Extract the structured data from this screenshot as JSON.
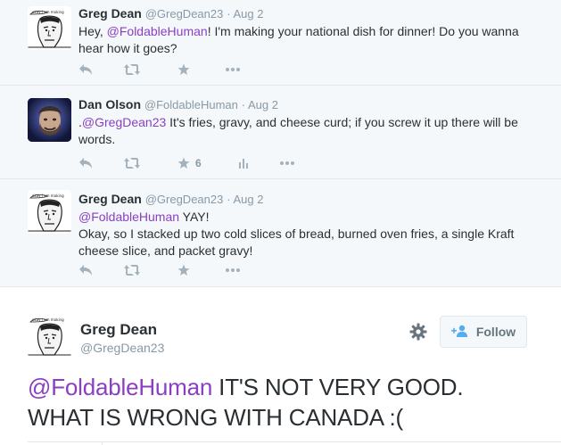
{
  "tweets": [
    {
      "name": "Greg Dean",
      "handle": "@GregDean23",
      "date": "· Aug 2",
      "text_pre": "Hey, ",
      "mention": "@FoldableHuman",
      "text_post": "! I'm making your national dish for dinner! Do you wanna hear how it goes?",
      "avatar": "comic-face-icon"
    },
    {
      "name": "Dan Olson",
      "handle": "@FoldableHuman",
      "date": "· Aug 2",
      "text_pre": ".",
      "mention": "@GregDean23",
      "text_post": " It's fries, gravy, and cheese curd; if you screw it up there will be words.",
      "favorite_count": "6",
      "avatar": "portrait-photo"
    },
    {
      "name": "Greg Dean",
      "handle": "@GregDean23",
      "date": "· Aug 2",
      "text_pre": "",
      "mention": "@FoldableHuman",
      "text_post": " YAY!",
      "text_line2": "Okay, so I stacked up two cold slices of bread, burned oven fries, a single Kraft cheese slice, and packet gravy!",
      "avatar": "comic-face-icon"
    }
  ],
  "main_tweet": {
    "name": "Greg Dean",
    "handle": "@GregDean23",
    "follow_label": "Follow",
    "mention": "@FoldableHuman",
    "text": " IT'S NOT VERY GOOD. WHAT IS WRONG WITH CANADA :("
  },
  "colors": {
    "link": "#8a3fc3",
    "icon": "#a5b2bc",
    "meta": "#8899a6"
  }
}
